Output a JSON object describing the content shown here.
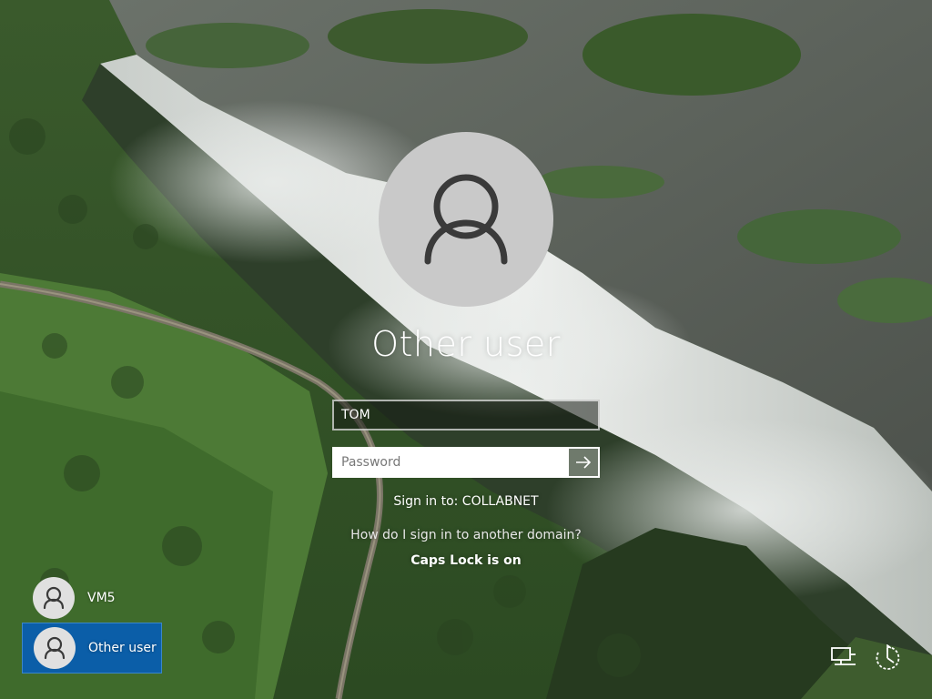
{
  "login": {
    "selected_user": "Other user",
    "username_value": "TOM",
    "password_placeholder": "Password",
    "sign_in_to": "Sign in to: COLLABNET",
    "other_domain_link": "How do I sign in to another domain?",
    "caps_lock_warning": "Caps Lock is on"
  },
  "user_list": [
    {
      "name": "VM5",
      "selected": false
    },
    {
      "name": "Other user",
      "selected": true
    }
  ],
  "system_icons": [
    "network-icon",
    "ease-of-access-power-icon"
  ],
  "colors": {
    "selected_tile": "#0b5ea8",
    "avatar_bg": "#c9c9c9",
    "submit_button": "#6f7a6c"
  }
}
